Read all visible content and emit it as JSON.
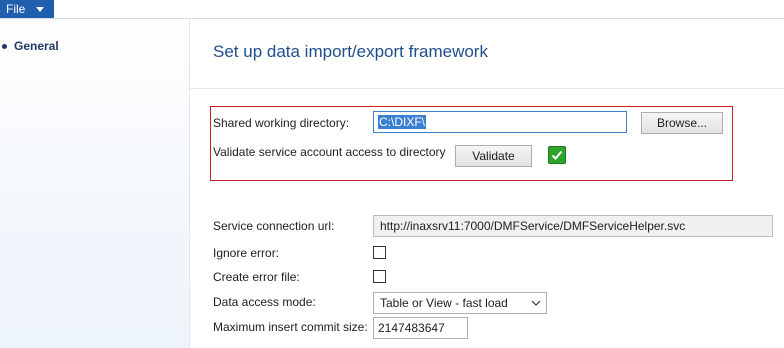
{
  "menu": {
    "file_label": "File"
  },
  "sidebar": {
    "items": [
      {
        "label": "General"
      }
    ]
  },
  "main": {
    "title": "Set up data import/export framework",
    "shared_dir": {
      "label": "Shared working directory:",
      "value": "C:\\DIXF\\",
      "browse_label": "Browse..."
    },
    "validate": {
      "label": "Validate service account access to directory",
      "button_label": "Validate",
      "status": "success",
      "status_color": "#2ea32e"
    },
    "service_url": {
      "label": "Service connection url:",
      "value": "http://inaxsrv11:7000/DMFService/DMFServiceHelper.svc"
    },
    "ignore_error": {
      "label": "Ignore error:",
      "checked": false
    },
    "create_error_file": {
      "label": "Create error file:",
      "checked": false
    },
    "data_access_mode": {
      "label": "Data access mode:",
      "value": "Table or View - fast load"
    },
    "max_commit": {
      "label": "Maximum insert commit size:",
      "value": "2147483647"
    }
  },
  "colors": {
    "accent": "#1f5fae",
    "title": "#1f4e8c",
    "highlight_border": "#c8202a"
  },
  "icons": {
    "file_dropdown": "caret-down-icon",
    "nav_bullet": "bullet-icon",
    "validate_status": "checkmark-icon",
    "select_dropdown": "chevron-down-icon"
  }
}
